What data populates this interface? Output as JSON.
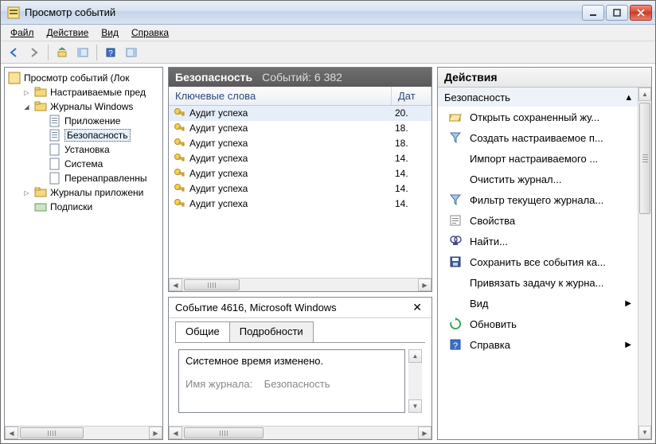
{
  "window": {
    "title": "Просмотр событий"
  },
  "menu": {
    "file": "Файл",
    "action": "Действие",
    "view": "Вид",
    "help": "Справка"
  },
  "tree": {
    "root": "Просмотр событий (Лок",
    "custom": "Настраиваемые пред",
    "winlogs": "Журналы Windows",
    "app": "Приложение",
    "security": "Безопасность",
    "setup": "Установка",
    "system": "Система",
    "forwarded": "Перенаправленны",
    "applogs": "Журналы приложени",
    "subs": "Подписки"
  },
  "center": {
    "title": "Безопасность",
    "subtitle": "Событий: 6 382",
    "col_keywords": "Ключевые слова",
    "col_date": "Дат",
    "events": [
      {
        "text": "Аудит успеха",
        "date": "20."
      },
      {
        "text": "Аудит успеха",
        "date": "18."
      },
      {
        "text": "Аудит успеха",
        "date": "18."
      },
      {
        "text": "Аудит успеха",
        "date": "14."
      },
      {
        "text": "Аудит успеха",
        "date": "14."
      },
      {
        "text": "Аудит успеха",
        "date": "14."
      },
      {
        "text": "Аудит успеха",
        "date": "14."
      }
    ],
    "detail_title": "Событие 4616, Microsoft Windows",
    "tab_general": "Общие",
    "tab_details": "Подробности",
    "detail_line1": "Системное время изменено.",
    "detail_line2a": "Имя журнала:",
    "detail_line2b": "Безопасность"
  },
  "actions": {
    "title": "Действия",
    "section": "Безопасность",
    "items": [
      {
        "icon": "folder-open",
        "label": "Открыть сохраненный жу..."
      },
      {
        "icon": "filter-new",
        "label": "Создать настраиваемое п..."
      },
      {
        "icon": "none",
        "label": "Импорт настраиваемого ..."
      },
      {
        "icon": "none",
        "label": "Очистить журнал..."
      },
      {
        "icon": "filter",
        "label": "Фильтр текущего журнала..."
      },
      {
        "icon": "props",
        "label": "Свойства"
      },
      {
        "icon": "find",
        "label": "Найти..."
      },
      {
        "icon": "save",
        "label": "Сохранить все события ка..."
      },
      {
        "icon": "none",
        "label": "Привязать задачу к журна..."
      },
      {
        "icon": "none",
        "label": "Вид",
        "submenu": true
      },
      {
        "icon": "refresh",
        "label": "Обновить"
      },
      {
        "icon": "help",
        "label": "Справка",
        "submenu": true
      }
    ]
  }
}
